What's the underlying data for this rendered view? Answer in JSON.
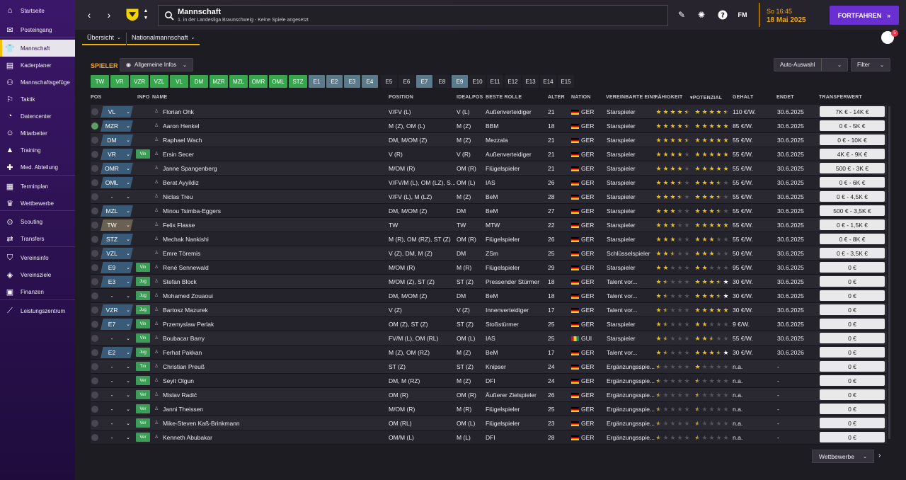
{
  "sidebar": {
    "items": [
      {
        "label": "Startseite",
        "icon": "home-icon",
        "glyph": "⌂"
      },
      {
        "label": "Posteingang",
        "icon": "inbox-icon",
        "glyph": "✉"
      },
      {
        "label": "Mannschaft",
        "icon": "shirt-icon",
        "glyph": "👕",
        "active": true
      },
      {
        "label": "Kaderplaner",
        "icon": "clipboard-icon",
        "glyph": "▤"
      },
      {
        "label": "Mannschaftsgefüge",
        "icon": "team-dynamics-icon",
        "glyph": "⚇"
      },
      {
        "label": "Taktik",
        "icon": "tactics-icon",
        "glyph": "⚐"
      },
      {
        "label": "Datencenter",
        "icon": "data-center-icon",
        "glyph": "◔"
      },
      {
        "label": "Mitarbeiter",
        "icon": "staff-icon",
        "glyph": "☺"
      },
      {
        "label": "Training",
        "icon": "training-icon",
        "glyph": "▲"
      },
      {
        "label": "Med. Abteilung",
        "icon": "medical-icon",
        "glyph": "✚"
      },
      {
        "label": "Terminplan",
        "icon": "calendar-icon",
        "glyph": "▦"
      },
      {
        "label": "Wettbewerbe",
        "icon": "trophy-icon",
        "glyph": "♛"
      },
      {
        "label": "Scouting",
        "icon": "scouting-icon",
        "glyph": "⊙"
      },
      {
        "label": "Transfers",
        "icon": "transfers-icon",
        "glyph": "⇄"
      },
      {
        "label": "Vereinsinfo",
        "icon": "club-info-icon",
        "glyph": "⛉"
      },
      {
        "label": "Vereinsziele",
        "icon": "club-goals-icon",
        "glyph": "◈"
      },
      {
        "label": "Finanzen",
        "icon": "finances-icon",
        "glyph": "▣"
      },
      {
        "label": "Leistungszentrum",
        "icon": "performance-icon",
        "glyph": "⟋"
      }
    ]
  },
  "header": {
    "title": "Mannschaft",
    "subtitle": "1. in der Landesliga Braunschweig - Keine Spiele angesetzt",
    "time": "So 16:45",
    "date": "18 Mai 2025",
    "continue_label": "FORTFAHREN",
    "fm_label": "FM",
    "notifications": "5"
  },
  "tabs": [
    {
      "label": "Übersicht"
    },
    {
      "label": "Nationalmannschaft"
    }
  ],
  "controls": {
    "section_label": "SPIELER",
    "view_dropdown": "Allgemeine Infos",
    "auto_select": "Auto-Auswahl",
    "filter": "Filter",
    "bottom_dropdown": "Wettbewerbe"
  },
  "filter_chips": [
    {
      "label": "TW",
      "style": "green"
    },
    {
      "label": "VR",
      "style": "green"
    },
    {
      "label": "VZR",
      "style": "green"
    },
    {
      "label": "VZL",
      "style": "green"
    },
    {
      "label": "VL",
      "style": "green"
    },
    {
      "label": "DM",
      "style": "green"
    },
    {
      "label": "MZR",
      "style": "green"
    },
    {
      "label": "MZL",
      "style": "green"
    },
    {
      "label": "OMR",
      "style": "green"
    },
    {
      "label": "OML",
      "style": "green"
    },
    {
      "label": "STZ",
      "style": "green"
    },
    {
      "label": "E1",
      "style": "slate"
    },
    {
      "label": "E2",
      "style": "slate"
    },
    {
      "label": "E3",
      "style": "slate"
    },
    {
      "label": "E4",
      "style": "slate"
    },
    {
      "label": "E5",
      "style": "dark"
    },
    {
      "label": "E6",
      "style": "dark"
    },
    {
      "label": "E7",
      "style": "slate"
    },
    {
      "label": "E8",
      "style": "dark"
    },
    {
      "label": "E9",
      "style": "slate"
    },
    {
      "label": "E10",
      "style": "dark"
    },
    {
      "label": "E11",
      "style": "dark"
    },
    {
      "label": "E12",
      "style": "dark"
    },
    {
      "label": "E13",
      "style": "dark"
    },
    {
      "label": "E14",
      "style": "dark"
    },
    {
      "label": "E15",
      "style": "dark"
    }
  ],
  "columns": {
    "pos": "POS",
    "info": "INFO",
    "name": "NAME",
    "position": "POSITION",
    "idealpos": "IDEALPOS",
    "role": "BESTE ROLLE",
    "age": "ALTER",
    "nation": "NATION",
    "status": "VEREINBARTE EINS...",
    "ability": "FÄHIGKEIT",
    "potential": "POTENZIAL",
    "wage": "GEHALT",
    "expires": "ENDET",
    "value": "TRANSFERWERT"
  },
  "players": [
    {
      "pos": "VL",
      "info": "",
      "check": false,
      "name": "Florian Ohk",
      "position": "V/FV (L)",
      "ideal": "V (L)",
      "role": "Außenverteidiger",
      "age": "21",
      "nation": "GER",
      "status": "Starspieler",
      "ability": 4.5,
      "potential": 4.5,
      "pot_type": "y",
      "wage": "110 €/W.",
      "expires": "30.6.2025",
      "value": "7K € - 14K €"
    },
    {
      "pos": "MZR",
      "info": "",
      "check": true,
      "name": "Aaron Henkel",
      "position": "M (Z), OM (L)",
      "ideal": "M (Z)",
      "role": "BBM",
      "age": "18",
      "nation": "GER",
      "status": "Starspieler",
      "ability": 4.5,
      "potential": 5,
      "pot_type": "y",
      "wage": "85 €/W.",
      "expires": "30.6.2025",
      "value": "0 € - 5K €"
    },
    {
      "pos": "DM",
      "info": "",
      "check": false,
      "name": "Raphael Wach",
      "position": "DM, M/OM (Z)",
      "ideal": "M (Z)",
      "role": "Mezzala",
      "age": "21",
      "nation": "GER",
      "status": "Starspieler",
      "ability": 4.5,
      "potential": 5,
      "pot_type": "y",
      "wage": "55 €/W.",
      "expires": "30.6.2025",
      "value": "0 € - 10K €"
    },
    {
      "pos": "VR",
      "info": "Vin",
      "check": false,
      "name": "Ersin Secer",
      "position": "V (R)",
      "ideal": "V (R)",
      "role": "Außenverteidiger",
      "age": "21",
      "nation": "GER",
      "status": "Starspieler",
      "ability": 4,
      "potential": 5,
      "pot_type": "w",
      "wage": "55 €/W.",
      "expires": "30.6.2025",
      "value": "4K € - 9K €"
    },
    {
      "pos": "OMR",
      "info": "",
      "check": false,
      "name": "Janne Spangenberg",
      "position": "M/OM (R)",
      "ideal": "OM (R)",
      "role": "Flügelspieler",
      "age": "21",
      "nation": "GER",
      "status": "Starspieler",
      "ability": 4,
      "potential": 5,
      "pot_type": "w",
      "wage": "55 €/W.",
      "expires": "30.6.2025",
      "value": "500 € - 3K €"
    },
    {
      "pos": "OML",
      "info": "",
      "check": false,
      "name": "Berat Ayyildiz",
      "position": "V/FV/M (L), OM (LZ), S...",
      "ideal": "OM (L)",
      "role": "IAS",
      "age": "26",
      "nation": "GER",
      "status": "Starspieler",
      "ability": 3.5,
      "potential": 3.5,
      "pot_type": "y",
      "wage": "55 €/W.",
      "expires": "30.6.2025",
      "value": "0 € - 6K €"
    },
    {
      "pos": "-",
      "info": "",
      "check": false,
      "name": "Niclas Treu",
      "position": "V/FV (L), M (LZ)",
      "ideal": "M (Z)",
      "role": "BeM",
      "age": "28",
      "nation": "GER",
      "status": "Starspieler",
      "ability": 3.5,
      "potential": 3.5,
      "pot_type": "y",
      "wage": "55 €/W.",
      "expires": "30.6.2025",
      "value": "0 € - 4,5K €"
    },
    {
      "pos": "MZL",
      "info": "",
      "check": false,
      "name": "Minou Tsimba-Eggers",
      "position": "DM, M/OM (Z)",
      "ideal": "DM",
      "role": "BeM",
      "age": "27",
      "nation": "GER",
      "status": "Starspieler",
      "ability": 3,
      "potential": 3.5,
      "pot_type": "y",
      "wage": "55 €/W.",
      "expires": "30.6.2025",
      "value": "500 € - 3,5K €"
    },
    {
      "pos": "TW",
      "info": "",
      "check": false,
      "name": "Felix Flasse",
      "position": "TW",
      "ideal": "TW",
      "role": "MTW",
      "age": "22",
      "nation": "GER",
      "status": "Starspieler",
      "ability": 3,
      "potential": 5,
      "pot_type": "y",
      "wage": "55 €/W.",
      "expires": "30.6.2025",
      "value": "0 € - 1,5K €"
    },
    {
      "pos": "STZ",
      "info": "",
      "check": false,
      "name": "Mechak Nankishi",
      "position": "M (R), OM (RZ), ST (Z)",
      "ideal": "OM (R)",
      "role": "Flügelspieler",
      "age": "26",
      "nation": "GER",
      "status": "Starspieler",
      "ability": 3,
      "potential": 3,
      "pot_type": "y",
      "wage": "55 €/W.",
      "expires": "30.6.2025",
      "value": "0 € - 8K €"
    },
    {
      "pos": "VZL",
      "info": "",
      "check": false,
      "name": "Emre Töremis",
      "position": "V (Z), DM, M (Z)",
      "ideal": "DM",
      "role": "ZSm",
      "age": "25",
      "nation": "GER",
      "status": "Schlüsselspieler",
      "ability": 2.5,
      "potential": 3,
      "pot_type": "y",
      "wage": "50 €/W.",
      "expires": "30.6.2025",
      "value": "0 € - 3,5K €"
    },
    {
      "pos": "E9",
      "info": "Vin",
      "check": false,
      "name": "René Sennewald",
      "position": "M/OM (R)",
      "ideal": "M (R)",
      "role": "Flügelspieler",
      "age": "29",
      "nation": "GER",
      "status": "Starspieler",
      "ability": 2,
      "potential": 2,
      "pot_type": "y",
      "wage": "95 €/W.",
      "expires": "30.6.2025",
      "value": "0 €"
    },
    {
      "pos": "E3",
      "info": "Jug",
      "check": false,
      "name": "Stefan Block",
      "position": "M/OM (Z), ST (Z)",
      "ideal": "ST (Z)",
      "role": "Pressender Stürmer",
      "age": "18",
      "nation": "GER",
      "status": "Talent vor...",
      "ability": 1.5,
      "potential": 3.5,
      "pot_type": "w",
      "wage": "30 €/W.",
      "expires": "30.6.2025",
      "value": "0 €"
    },
    {
      "pos": "-",
      "info": "Jug",
      "check": false,
      "name": "Mohamed Zouaoui",
      "position": "DM, M/OM (Z)",
      "ideal": "DM",
      "role": "BeM",
      "age": "18",
      "nation": "GER",
      "status": "Talent vor...",
      "ability": 1.5,
      "potential": 3.5,
      "pot_type": "w",
      "wage": "30 €/W.",
      "expires": "30.6.2025",
      "value": "0 €"
    },
    {
      "pos": "VZR",
      "info": "Jug",
      "check": false,
      "name": "Bartosz Mazurek",
      "position": "V (Z)",
      "ideal": "V (Z)",
      "role": "Innenverteidiger",
      "age": "17",
      "nation": "GER",
      "status": "Talent vor...",
      "ability": 1.5,
      "potential": 5,
      "pot_type": "y",
      "wage": "30 €/W.",
      "expires": "30.6.2025",
      "value": "0 €"
    },
    {
      "pos": "E7",
      "info": "Vin",
      "check": false,
      "name": "Przemyslaw Perlak",
      "position": "OM (Z), ST (Z)",
      "ideal": "ST (Z)",
      "role": "Stoßstürmer",
      "age": "25",
      "nation": "GER",
      "status": "Starspieler",
      "ability": 1.5,
      "potential": 2,
      "pot_type": "y",
      "wage": "9 €/W.",
      "expires": "30.6.2025",
      "value": "0 €"
    },
    {
      "pos": "-",
      "info": "Vin",
      "check": false,
      "name": "Boubacar Barry",
      "position": "FV/M (L), OM (RL)",
      "ideal": "OM (L)",
      "role": "IAS",
      "age": "25",
      "nation": "GUI",
      "status": "Starspieler",
      "ability": 1.5,
      "potential": 2.5,
      "pot_type": "y",
      "wage": "55 €/W.",
      "expires": "30.6.2025",
      "value": "0 €"
    },
    {
      "pos": "E2",
      "info": "Jug",
      "check": false,
      "name": "Ferhat Pakkan",
      "position": "M (Z), OM (RZ)",
      "ideal": "M (Z)",
      "role": "BeM",
      "age": "17",
      "nation": "GER",
      "status": "Talent vor...",
      "ability": 1.5,
      "potential": 3.5,
      "pot_type": "w",
      "wage": "30 €/W.",
      "expires": "30.6.2026",
      "value": "0 €"
    },
    {
      "pos": "-",
      "info": "Tm",
      "check": false,
      "name": "Christian Preuß",
      "position": "ST (Z)",
      "ideal": "ST (Z)",
      "role": "Knipser",
      "age": "24",
      "nation": "GER",
      "status": "Ergänzungsspie...",
      "ability": 0.5,
      "potential": 1,
      "pot_type": "y",
      "wage": "n.a.",
      "expires": "-",
      "value": "0 €"
    },
    {
      "pos": "-",
      "info": "Ver",
      "check": false,
      "name": "Seyit Olgun",
      "position": "DM, M (RZ)",
      "ideal": "M (Z)",
      "role": "DFI",
      "age": "24",
      "nation": "GER",
      "status": "Ergänzungsspie...",
      "ability": 0.5,
      "potential": 0.5,
      "pot_type": "y",
      "wage": "n.a.",
      "expires": "-",
      "value": "0 €"
    },
    {
      "pos": "-",
      "info": "Ver",
      "check": false,
      "name": "Mislav Radić",
      "position": "OM (R)",
      "ideal": "OM (R)",
      "role": "Äußerer Zielspieler",
      "age": "26",
      "nation": "GER",
      "status": "Ergänzungsspie...",
      "ability": 0.5,
      "potential": 0.5,
      "pot_type": "y",
      "wage": "n.a.",
      "expires": "-",
      "value": "0 €"
    },
    {
      "pos": "-",
      "info": "Ver",
      "check": false,
      "name": "Janni Theissen",
      "position": "M/OM (R)",
      "ideal": "M (R)",
      "role": "Flügelspieler",
      "age": "25",
      "nation": "GER",
      "status": "Ergänzungsspie...",
      "ability": 0.5,
      "potential": 0.5,
      "pot_type": "y",
      "wage": "n.a.",
      "expires": "-",
      "value": "0 €"
    },
    {
      "pos": "-",
      "info": "Ver",
      "check": false,
      "name": "Mike-Steven Kaß-Brinkmann",
      "position": "OM (RL)",
      "ideal": "OM (L)",
      "role": "Flügelspieler",
      "age": "23",
      "nation": "GER",
      "status": "Ergänzungsspie...",
      "ability": 0.5,
      "potential": 0.5,
      "pot_type": "y",
      "wage": "n.a.",
      "expires": "-",
      "value": "0 €"
    },
    {
      "pos": "-",
      "info": "Ver",
      "check": false,
      "name": "Kenneth Abubakar",
      "position": "OM/M (L)",
      "ideal": "M (L)",
      "role": "DFI",
      "age": "28",
      "nation": "GER",
      "status": "Ergänzungsspie...",
      "ability": 0.5,
      "potential": 0.5,
      "pot_type": "y",
      "wage": "n.a.",
      "expires": "-",
      "value": "0 €"
    }
  ]
}
